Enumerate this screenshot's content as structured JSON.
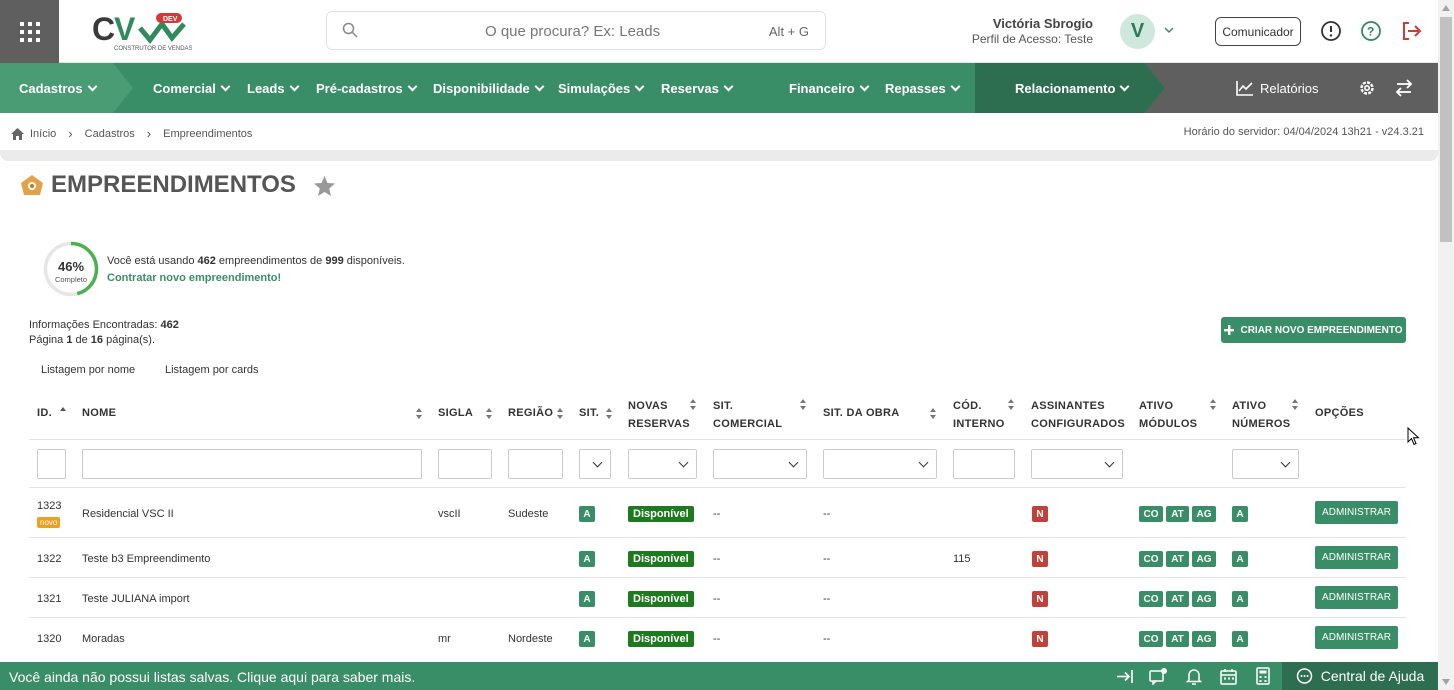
{
  "header": {
    "search_placeholder": "O que procura? Ex: Leads",
    "search_shortcut": "Alt + G",
    "user_name": "Victória Sbrogio",
    "user_profile": "Perfil de Acesso: Teste",
    "avatar_letter": "V",
    "communicator": "Comunicador",
    "logo_text": "CV",
    "logo_badge": "DEV",
    "logo_sub": "CONSTRUTOR DE VENDAS"
  },
  "nav": {
    "items": [
      "Cadastros",
      "Comercial",
      "Leads",
      "Pré-cadastros",
      "Disponibilidade",
      "Simulações",
      "Reservas",
      "Financeiro",
      "Repasses",
      "Relacionamento"
    ],
    "reports": "Relatórios"
  },
  "breadcrumb": {
    "items": [
      "Início",
      "Cadastros",
      "Empreendimentos"
    ]
  },
  "server_time": "Horário do servidor: 04/04/2024 13h21 - v24.3.21",
  "page_title": "EMPREENDIMENTOS",
  "usage": {
    "percent_label": "46%",
    "percent": 46,
    "complete_label": "Completo",
    "text_prefix": "Você está usando ",
    "used": "462",
    "text_mid": " empreendimentos de ",
    "total": "999",
    "text_suffix": " disponíveis.",
    "link": "Contratar novo empreendimento!"
  },
  "results": {
    "found_label": "Informações Encontradas: ",
    "found": "462",
    "page_prefix": "Página ",
    "page": "1",
    "page_mid": " de ",
    "pages": "16",
    "page_suffix": " página(s)."
  },
  "create_button": "CRIAR NOVO EMPREENDIMENTO",
  "tabs": [
    "Listagem por nome",
    "Listagem por cards"
  ],
  "columns": {
    "id": "ID.",
    "nome": "NOME",
    "sigla": "SIGLA",
    "regiao": "REGIÃO",
    "sit": "SIT.",
    "novas1": "NOVAS",
    "novas2": "RESERVAS",
    "sitcom1": "SIT.",
    "sitcom2": "COMERCIAL",
    "obra": "SIT. DA OBRA",
    "cod1": "CÓD.",
    "cod2": "INTERNO",
    "assin1": "ASSINANTES",
    "assin2": "CONFIGURADOS",
    "mod1": "ATIVO",
    "mod2": "MÓDULOS",
    "num1": "ATIVO",
    "num2": "NÚMEROS",
    "opcoes": "OPÇÕES"
  },
  "rows": [
    {
      "id": "1323",
      "novo": "novo",
      "nome": "Residencial VSC II",
      "sigla": "vscII",
      "regiao": "Sudeste",
      "sit": "A",
      "novas": "Disponível",
      "sitcom": "--",
      "obra": "--",
      "cod": "",
      "assin": "N",
      "mods": [
        "CO",
        "AT",
        "AG"
      ],
      "num": "A",
      "action": "ADMINISTRAR"
    },
    {
      "id": "1322",
      "nome": "Teste b3 Empreendimento",
      "sigla": "",
      "regiao": "",
      "sit": "A",
      "novas": "Disponível",
      "sitcom": "--",
      "obra": "--",
      "cod": "115",
      "assin": "N",
      "mods": [
        "CO",
        "AT",
        "AG"
      ],
      "num": "A",
      "action": "ADMINISTRAR"
    },
    {
      "id": "1321",
      "nome": "Teste JULIANA import",
      "sigla": "",
      "regiao": "",
      "sit": "A",
      "novas": "Disponível",
      "sitcom": "--",
      "obra": "--",
      "cod": "",
      "assin": "N",
      "mods": [
        "CO",
        "AT",
        "AG"
      ],
      "num": "A",
      "action": "ADMINISTRAR"
    },
    {
      "id": "1320",
      "nome": "Moradas",
      "sigla": "mr",
      "regiao": "Nordeste",
      "sit": "A",
      "novas": "Disponível",
      "sitcom": "--",
      "obra": "--",
      "cod": "",
      "assin": "N",
      "mods": [
        "CO",
        "AT",
        "AG"
      ],
      "num": "A",
      "action": "ADMINISTRAR"
    }
  ],
  "footer": {
    "text": "Você ainda não possui listas salvas. Clique aqui para saber mais.",
    "help": "Central de Ajuda"
  },
  "colors": {
    "primary": "#3a8e67",
    "dark": "#2d6e50",
    "danger": "#c0413b",
    "badge_green": "#1e7a1e",
    "novo": "#f0a020"
  }
}
